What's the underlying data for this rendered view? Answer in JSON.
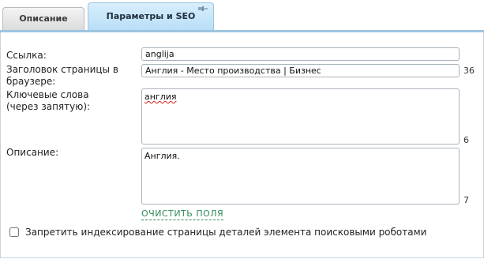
{
  "tabs": [
    {
      "label": "Описание",
      "active": false
    },
    {
      "label": "Параметры и SEO",
      "active": true
    }
  ],
  "form": {
    "link": {
      "label": "Ссылка:",
      "value": "anglija"
    },
    "title": {
      "label": "Заголовок страницы в\nбраузере:",
      "value": "Англия - Место производства | Бизнес",
      "count": "36"
    },
    "keywords": {
      "label": "Ключевые слова\n(через запятую):",
      "value": "англия",
      "count": "6"
    },
    "description": {
      "label": "Описание:",
      "value": "Англия.",
      "count": "7"
    },
    "clear_link": "ОЧИСТИТЬ ПОЛЯ",
    "noindex": {
      "label": "Запретить индексирование страницы деталей элемента поисковыми роботами",
      "checked": false
    }
  },
  "colors": {
    "active_tab": "#c6e5f9",
    "link": "#2e8b57",
    "spellcheck": "#d02020"
  },
  "icons": {
    "tab_pin": "pin-icon"
  }
}
